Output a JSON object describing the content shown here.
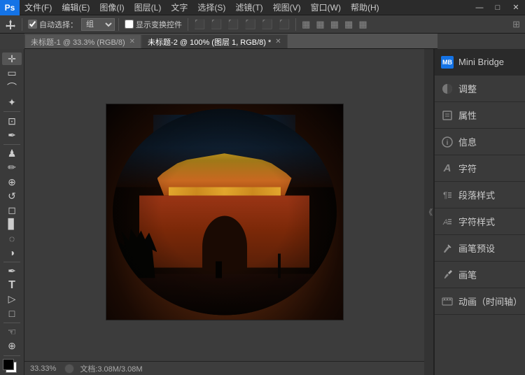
{
  "menu": {
    "logo": "Ps",
    "items": [
      {
        "label": "文件(F)",
        "key": "file"
      },
      {
        "label": "编辑(E)",
        "key": "edit"
      },
      {
        "label": "图像(I)",
        "key": "image"
      },
      {
        "label": "图层(L)",
        "key": "layers"
      },
      {
        "label": "文字",
        "key": "text"
      },
      {
        "label": "选择(S)",
        "key": "select"
      },
      {
        "label": "滤镜(T)",
        "key": "filter"
      },
      {
        "label": "视图(V)",
        "key": "view"
      },
      {
        "label": "窗口(W)",
        "key": "window"
      },
      {
        "label": "帮助(H)",
        "key": "help"
      }
    ],
    "win_controls": [
      "—",
      "□",
      "×"
    ]
  },
  "toolbar": {
    "move_tool": "移动工具",
    "auto_select_label": "自动选择：",
    "auto_select_option": "组",
    "transform_control": "显示变换控件"
  },
  "tabs": [
    {
      "label": "未标题-1 @ 33.3% (RGB/8)",
      "active": false
    },
    {
      "label": "未标题-2 @ 100% (图层 1, RGB/8) *",
      "active": true
    }
  ],
  "tools": [
    {
      "icon": "↔",
      "name": "move-tool"
    },
    {
      "icon": "▭",
      "name": "marquee-tool"
    },
    {
      "icon": "◌",
      "name": "ellipse-marquee"
    },
    {
      "icon": "✦",
      "name": "lasso-tool"
    },
    {
      "icon": "⊹",
      "name": "magic-wand"
    },
    {
      "icon": "✂",
      "name": "crop-tool"
    },
    {
      "icon": "✒",
      "name": "eyedropper"
    },
    {
      "icon": "♟",
      "name": "healing-brush"
    },
    {
      "icon": "✏",
      "name": "brush-tool"
    },
    {
      "icon": "⬚",
      "name": "clone-stamp"
    },
    {
      "icon": "◈",
      "name": "history-brush"
    },
    {
      "icon": "◻",
      "name": "eraser"
    },
    {
      "icon": "▊",
      "name": "gradient-tool"
    },
    {
      "icon": "◆",
      "name": "blur-tool"
    },
    {
      "icon": "◐",
      "name": "dodge-tool"
    },
    {
      "icon": "✦",
      "name": "pen-tool"
    },
    {
      "icon": "T",
      "name": "type-tool"
    },
    {
      "icon": "▷",
      "name": "path-selection"
    },
    {
      "icon": "□",
      "name": "shape-tool"
    },
    {
      "icon": "☜",
      "name": "hand-tool"
    },
    {
      "icon": "🔍",
      "name": "zoom-tool"
    }
  ],
  "status": {
    "zoom": "33.33%",
    "doc_info": "文档:3.08M/3.08M"
  },
  "right_panel": {
    "items": [
      {
        "label": "Mini Bridge",
        "icon": "MB",
        "key": "mini-bridge"
      },
      {
        "label": "调整",
        "icon": "◑",
        "key": "adjustments"
      },
      {
        "label": "属性",
        "icon": "📋",
        "key": "properties"
      },
      {
        "label": "信息",
        "icon": "ℹ",
        "key": "info"
      },
      {
        "label": "字符",
        "icon": "A",
        "key": "character"
      },
      {
        "label": "段落样式",
        "icon": "¶",
        "key": "paragraph-styles"
      },
      {
        "label": "字符样式",
        "icon": "A",
        "key": "character-styles"
      },
      {
        "label": "画笔预设",
        "icon": "✒",
        "key": "brush-presets"
      },
      {
        "label": "画笔",
        "icon": "✏",
        "key": "brush"
      },
      {
        "label": "动画（时间轴）",
        "icon": "▶",
        "key": "animation"
      }
    ]
  }
}
